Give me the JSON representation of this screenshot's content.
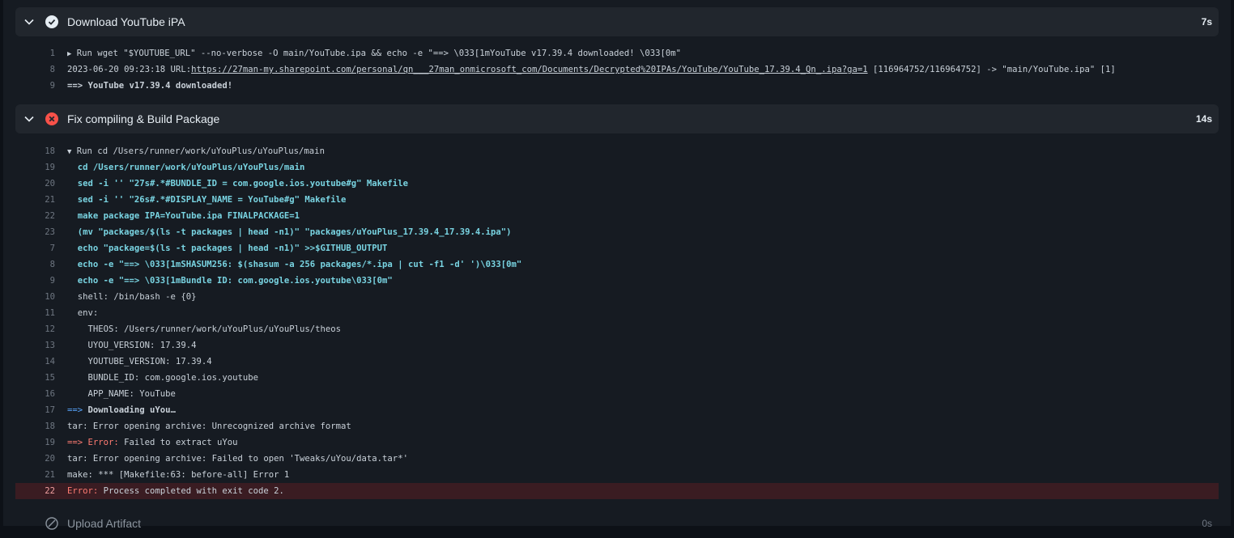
{
  "steps": [
    {
      "title": "Download YouTube iPA",
      "duration": "7s",
      "status": "success"
    },
    {
      "title": "Fix compiling & Build Package",
      "duration": "14s",
      "status": "failure"
    },
    {
      "title": "Upload Artifact",
      "duration": "0s",
      "status": "skipped"
    }
  ],
  "log1": [
    {
      "n": "1",
      "tri": "▶",
      "t": " Run wget \"$YOUTUBE_URL\" --no-verbose -O main/YouTube.ipa && echo -e \"==> \\033[1mYouTube v17.39.4 downloaded! \\033[0m\""
    },
    {
      "n": "8",
      "pre": "2023-06-20 09:23:18 URL:",
      "url": "https://27man-my.sharepoint.com/personal/qn___27man_onmicrosoft_com/Documents/Decrypted%20IPAs/YouTube/YouTube_17.39.4_Qn_.ipa?ga=1",
      "post": " [116964752/116964752] -> \"main/YouTube.ipa\" [1]"
    },
    {
      "n": "9",
      "t": "==> YouTube v17.39.4 downloaded!"
    }
  ],
  "log2": [
    {
      "n": "18",
      "tri": "▼",
      "t": " Run cd /Users/runner/work/uYouPlus/uYouPlus/main"
    },
    {
      "n": "19",
      "cyan": "  cd /Users/runner/work/uYouPlus/uYouPlus/main"
    },
    {
      "n": "20",
      "cyan": "  sed -i '' \"27s#.*#BUNDLE_ID = com.google.ios.youtube#g\" Makefile"
    },
    {
      "n": "21",
      "cyan": "  sed -i '' \"26s#.*#DISPLAY_NAME = YouTube#g\" Makefile"
    },
    {
      "n": "22",
      "cyan": "  make package IPA=YouTube.ipa FINALPACKAGE=1"
    },
    {
      "n": "23",
      "cyan": "  (mv \"packages/$(ls -t packages | head -n1)\" \"packages/uYouPlus_17.39.4_17.39.4.ipa\")"
    },
    {
      "n": "7",
      "cyan": "  echo \"package=$(ls -t packages | head -n1)\" >>$GITHUB_OUTPUT"
    },
    {
      "n": "8",
      "cyan": "  echo -e \"==> \\033[1mSHASUM256: $(shasum -a 256 packages/*.ipa | cut -f1 -d' ')\\033[0m\""
    },
    {
      "n": "9",
      "cyan": "  echo -e \"==> \\033[1mBundle ID: com.google.ios.youtube\\033[0m\""
    },
    {
      "n": "10",
      "t": "  shell: /bin/bash -e {0}"
    },
    {
      "n": "11",
      "t": "  env:"
    },
    {
      "n": "12",
      "t": "    THEOS: /Users/runner/work/uYouPlus/uYouPlus/theos"
    },
    {
      "n": "13",
      "t": "    UYOU_VERSION: 17.39.4"
    },
    {
      "n": "14",
      "t": "    YOUTUBE_VERSION: 17.39.4"
    },
    {
      "n": "15",
      "t": "    BUNDLE_ID: com.google.ios.youtube"
    },
    {
      "n": "16",
      "t": "    APP_NAME: YouTube"
    },
    {
      "n": "17",
      "blue": "==> ",
      "bold": "Downloading uYou…"
    },
    {
      "n": "18",
      "t": "tar: Error opening archive: Unrecognized archive format"
    },
    {
      "n": "19",
      "red": "==> Error:",
      "t": " Failed to extract uYou"
    },
    {
      "n": "20",
      "t": "tar: Error opening archive: Failed to open 'Tweaks/uYou/data.tar*'"
    },
    {
      "n": "21",
      "t": "make: *** [Makefile:63: before-all] Error 1"
    },
    {
      "n": "22",
      "red": "Error:",
      "t": " Process completed with exit code 2.",
      "error": true
    }
  ],
  "colors": {
    "success": "#e6edf3",
    "failure": "#f85149",
    "background": "#161b22"
  },
  "icons": {
    "expand": "chevron-down-icon",
    "success": "check-circle-icon",
    "failure": "x-circle-icon",
    "skipped": "skipped-circle-icon"
  }
}
